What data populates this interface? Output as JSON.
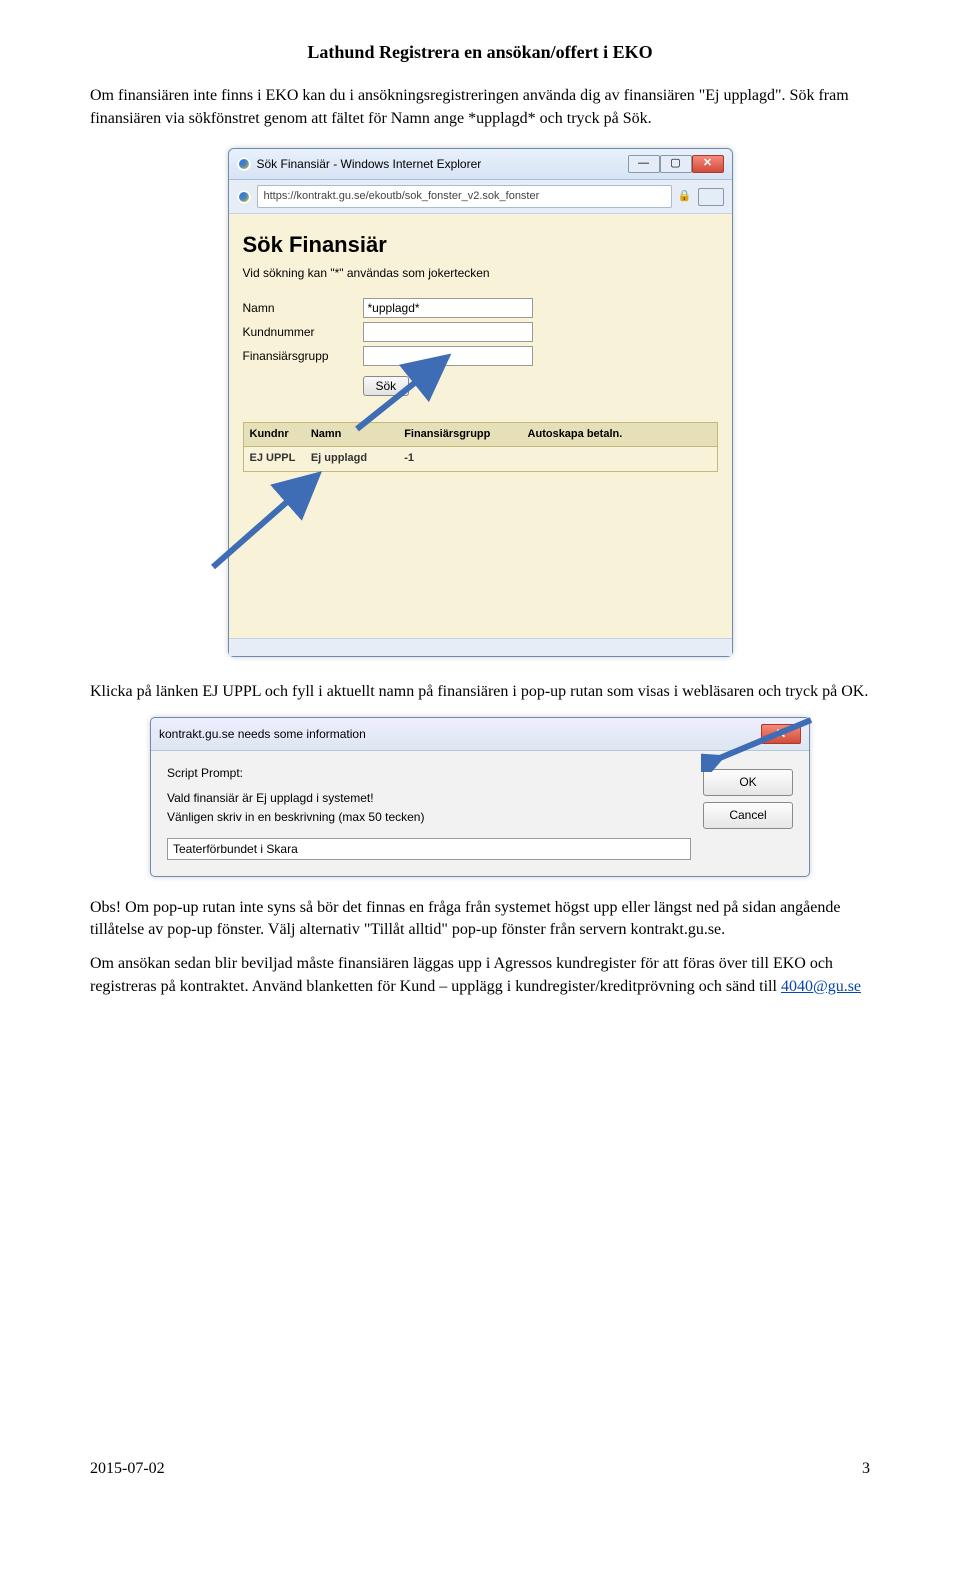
{
  "title": "Lathund Registrera en ansökan/offert i EKO",
  "p1": "Om finansiären inte finns i EKO kan du i ansökningsregistreringen använda dig av finansiären \"Ej upplagd\". Sök fram finansiären via sökfönstret genom att fältet för Namn ange *upplagd* och tryck på Sök.",
  "win1": {
    "wintitle": "Sök Finansiär - Windows Internet Explorer",
    "url": "https://kontrakt.gu.se/ekoutb/sok_fonster_v2.sok_fonster",
    "heading": "Sök Finansiär",
    "subtext": "Vid sökning kan \"*\" användas som jokertecken",
    "lbl_namn": "Namn",
    "lbl_kund": "Kundnummer",
    "lbl_grp": "Finansiärsgrupp",
    "val_namn": "*upplagd*",
    "sok": "Sök",
    "th1": "Kundnr",
    "th2": "Namn",
    "th3": "Finansiärsgrupp",
    "th4": "Autoskapa betaln.",
    "td1": "EJ UPPL",
    "td2": "Ej upplagd",
    "td3": "-1"
  },
  "p2": "Klicka på länken EJ UPPL och fyll i aktuellt namn på finansiären i pop-up rutan som visas i webläsaren och tryck på OK.",
  "dlg": {
    "bartitle": "kontrakt.gu.se needs some information",
    "sp": "Script Prompt:",
    "l1": "Vald finansiär är Ej upplagd i systemet!",
    "l2": "Vänligen skriv in en beskrivning (max 50 tecken)",
    "input": "Teaterförbundet i Skara",
    "ok": "OK",
    "cancel": "Cancel"
  },
  "p3a": "Obs! Om pop-up rutan inte syns så bör det finnas en fråga från systemet högst upp eller längst ned på sidan angående tillåtelse av pop-up fönster. Välj alternativ \"Tillåt alltid\" pop-up fönster från servern kontrakt.gu.se.",
  "p3b_1": "Om ansökan sedan blir beviljad måste finansiären läggas upp i Agressos kundregister för att föras över till EKO och registreras på kontraktet. Använd blanketten för Kund – upplägg i kundregister/kreditprövning och sänd till ",
  "p3b_link": "4040@gu.se",
  "footer_date": "2015-07-02",
  "footer_page": "3"
}
